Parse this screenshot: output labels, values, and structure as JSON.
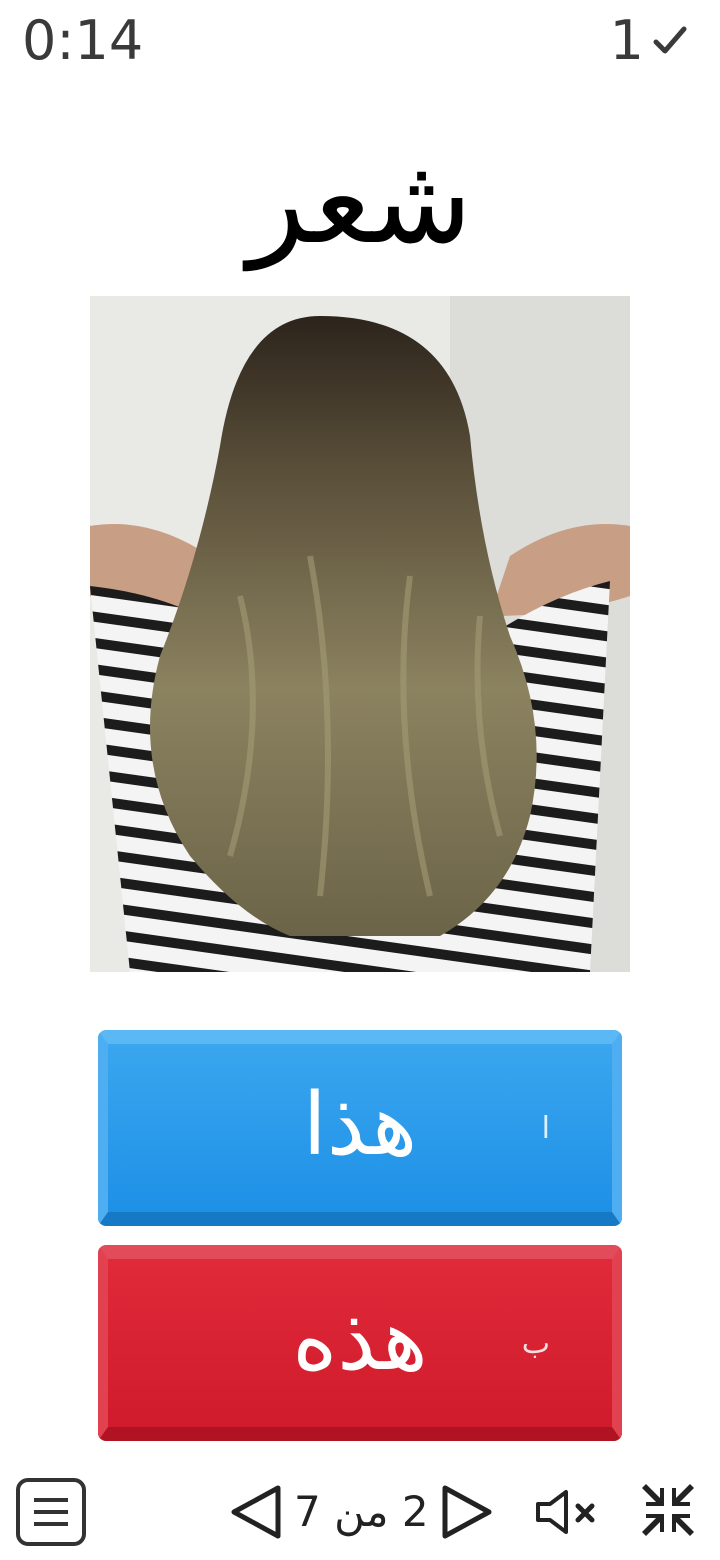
{
  "header": {
    "timer": "0:14",
    "score": "1",
    "score_icon": "check-icon"
  },
  "question": {
    "word": "شعر",
    "image": "woman-long-wavy-hair-photo"
  },
  "answers": [
    {
      "key": "ا",
      "label": "هذا",
      "color": "#1e90e6"
    },
    {
      "key": "ب",
      "label": "هذه",
      "color": "#d01b2c"
    }
  ],
  "footer": {
    "menu_icon": "menu-icon",
    "pager_text": "2 من 7",
    "prev_icon": "triangle-left-icon",
    "next_icon": "triangle-right-icon",
    "mute_icon": "speaker-muted-icon",
    "collapse_icon": "collapse-icon"
  }
}
